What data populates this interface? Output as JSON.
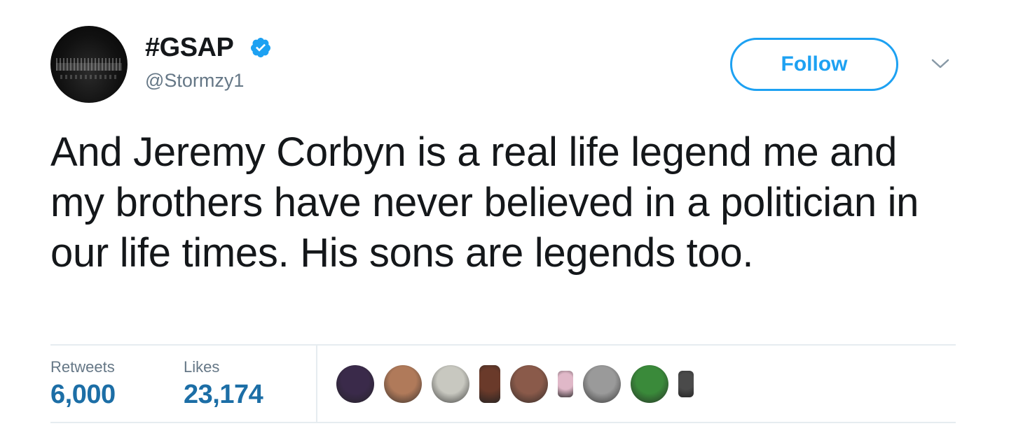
{
  "user": {
    "display_name": "#GSAP",
    "handle": "@Stormzy1",
    "verified": true
  },
  "follow_button": {
    "label": "Follow"
  },
  "tweet": {
    "text": "And Jeremy Corbyn is a real life legend me and my brothers have never believed in a politician in our life times. His sons are legends too."
  },
  "stats": {
    "retweets_label": "Retweets",
    "retweets_value": "6,000",
    "likes_label": "Likes",
    "likes_value": "23,174"
  },
  "likers": [
    {
      "icon": "liker-avatar-1",
      "color": "#3a2a4a"
    },
    {
      "icon": "liker-avatar-2",
      "color": "#b07a5a"
    },
    {
      "icon": "liker-avatar-3",
      "color": "#c8c8c0"
    },
    {
      "icon": "liker-avatar-4",
      "color": "#6a3a2a"
    },
    {
      "icon": "liker-avatar-5",
      "color": "#8a5a4a"
    },
    {
      "icon": "liker-avatar-6",
      "color": "#e0b8c8"
    },
    {
      "icon": "liker-avatar-7",
      "color": "#9a9a9a"
    },
    {
      "icon": "liker-avatar-8",
      "color": "#3a8a3a"
    },
    {
      "icon": "liker-avatar-9",
      "color": "#4a4a4a"
    }
  ],
  "colors": {
    "accent": "#1da1f2",
    "stat_value": "#1c6ea6",
    "muted": "#657786",
    "divider": "#e6ecf0"
  }
}
